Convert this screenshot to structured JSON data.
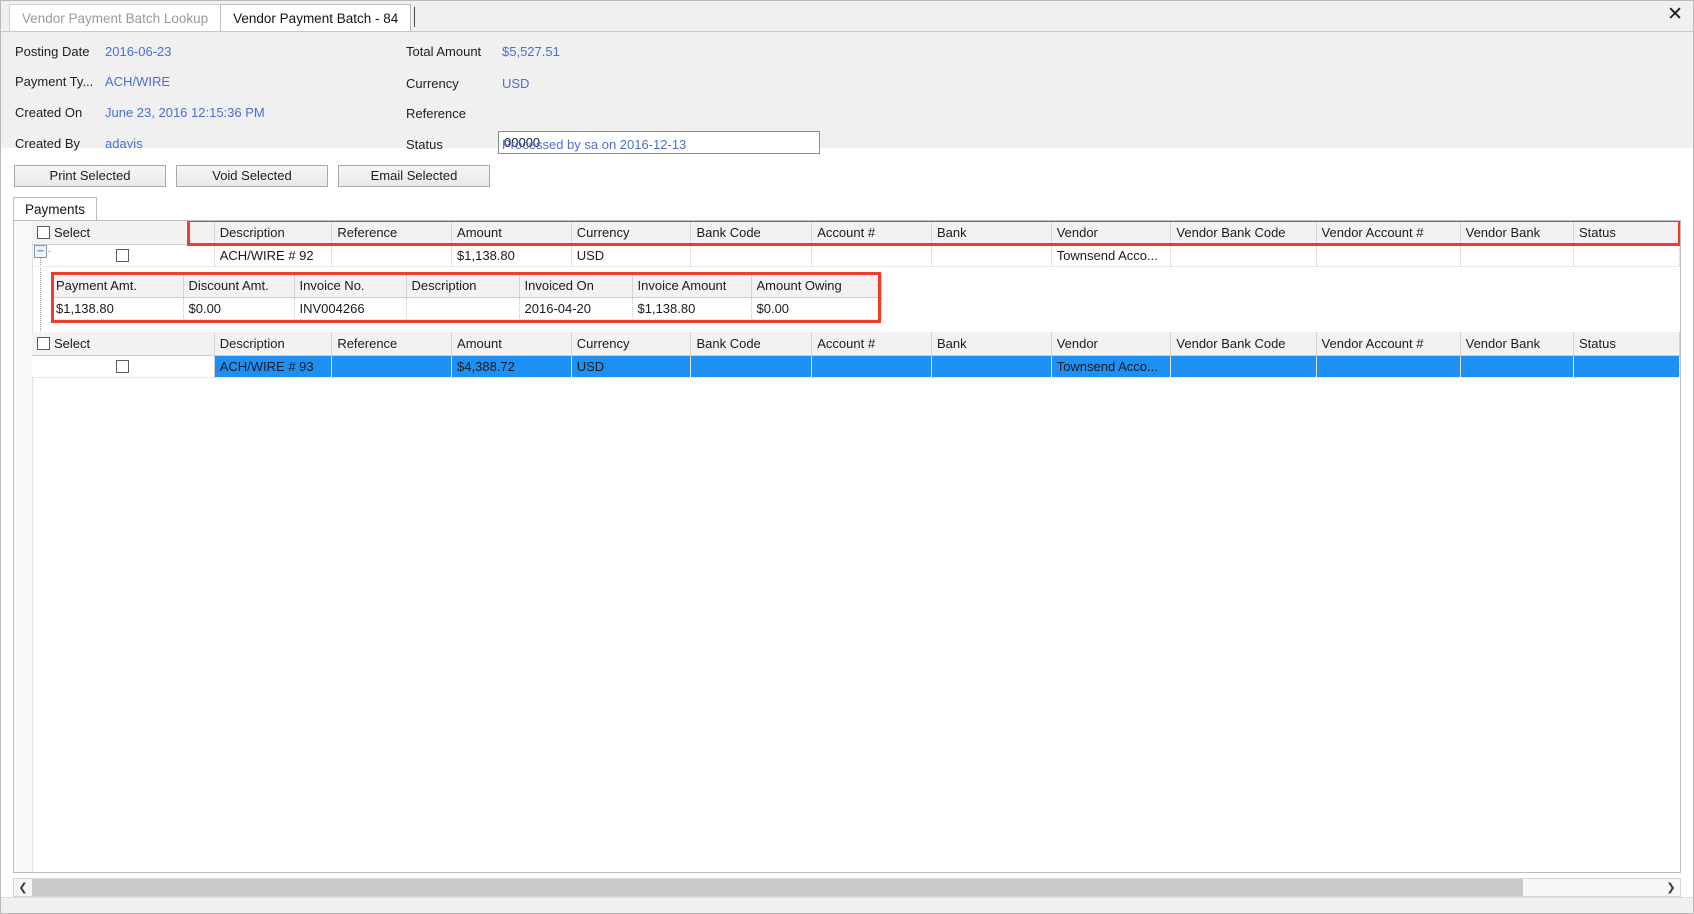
{
  "window": {
    "close_label": "✕"
  },
  "tabs": [
    {
      "label": "Vendor Payment Batch Lookup",
      "active": false
    },
    {
      "label": "Vendor Payment Batch - 84",
      "active": true
    }
  ],
  "header": {
    "left_fields": [
      {
        "label": "Posting Date",
        "value": "2016-06-23"
      },
      {
        "label": "Payment Ty...",
        "value": "ACH/WIRE"
      },
      {
        "label": "Created On",
        "value": "June 23, 2016 12:15:36 PM"
      },
      {
        "label": "Created By",
        "value": "adavis"
      }
    ],
    "right_fields": [
      {
        "label": "Total Amount",
        "value": "$5,527.51"
      },
      {
        "label": "Currency",
        "value": "USD"
      },
      {
        "label": "Reference",
        "value": ""
      },
      {
        "label": "Status",
        "value": "Processed by sa on 2016-12-13"
      }
    ],
    "reference_input": {
      "value": "00000",
      "placeholder": ""
    }
  },
  "toolbar": {
    "print_selected": "Print Selected",
    "void_selected": "Void Selected",
    "email_selected": "Email Selected"
  },
  "subtabs": [
    {
      "label": "Payments",
      "active": true
    }
  ],
  "grid": {
    "columns": [
      "Select",
      "Description",
      "Reference",
      "Amount",
      "Currency",
      "Bank Code",
      "Account #",
      "Bank",
      "Vendor",
      "Vendor Bank Code",
      "Vendor Account #",
      "Vendor Bank",
      "Status"
    ],
    "rows": [
      {
        "selected": false,
        "expanded": true,
        "checked": false,
        "cells": {
          "description": "ACH/WIRE # 92",
          "reference": "",
          "amount": "$1,138.80",
          "currency": "USD",
          "bank_code": "",
          "account_no": "",
          "bank": "",
          "vendor": "Townsend Acco...",
          "vendor_bank_code": "",
          "vendor_account_no": "",
          "vendor_bank": "",
          "status": ""
        }
      },
      {
        "selected": true,
        "expanded": false,
        "checked": false,
        "cells": {
          "description": "ACH/WIRE # 93",
          "reference": "",
          "amount": "$4,388.72",
          "currency": "USD",
          "bank_code": "",
          "account_no": "",
          "bank": "",
          "vendor": "Townsend Acco...",
          "vendor_bank_code": "",
          "vendor_account_no": "",
          "vendor_bank": "",
          "status": ""
        }
      }
    ]
  },
  "detail_grid": {
    "columns": [
      "Payment Amt.",
      "Discount Amt.",
      "Invoice No.",
      "Description",
      "Invoiced On",
      "Invoice Amount",
      "Amount Owing"
    ],
    "rows": [
      {
        "payment_amt": "$1,138.80",
        "discount_amt": "$0.00",
        "invoice_no": "INV004266",
        "description": "",
        "invoiced_on": "2016-04-20",
        "invoice_amount": "$1,138.80",
        "amount_owing": "$0.00"
      }
    ]
  },
  "scrollbar": {
    "left_arrow": "❮",
    "right_arrow": "❯"
  },
  "colors": {
    "link": "#4a6fd4",
    "selection": "#1e90f4",
    "highlight": "#ef3c2d",
    "panel": "#f0f0f0"
  }
}
